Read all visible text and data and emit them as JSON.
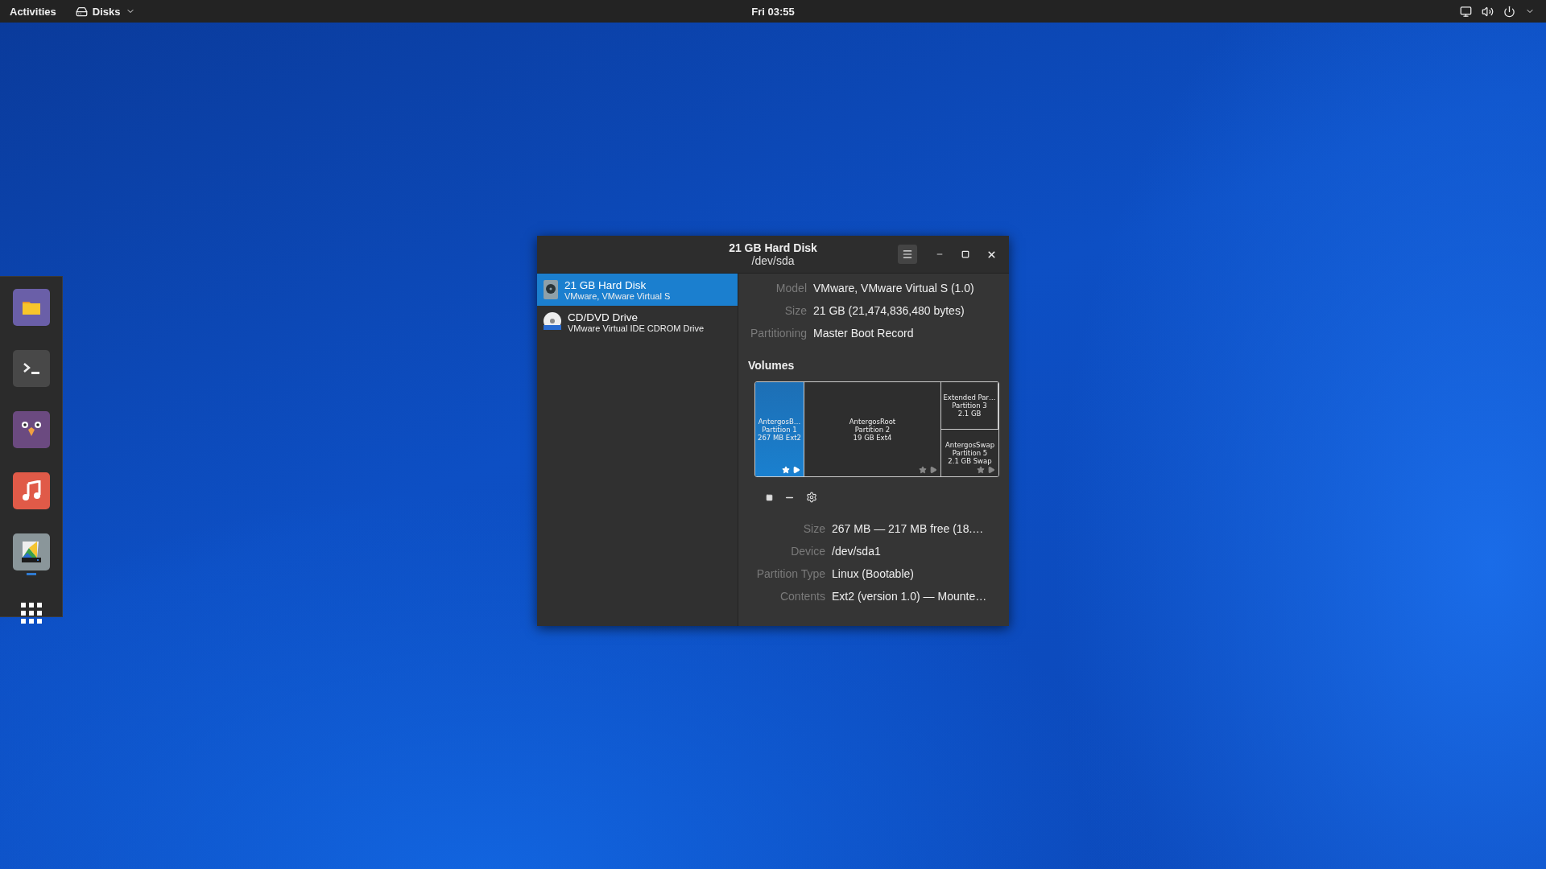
{
  "top_bar": {
    "activities": "Activities",
    "app_menu": {
      "label": "Disks"
    },
    "clock": "Fri 03:55"
  },
  "dock": {
    "items": [
      {
        "kind": "files",
        "running": false
      },
      {
        "kind": "terminal",
        "running": false
      },
      {
        "kind": "chat",
        "running": false
      },
      {
        "kind": "music",
        "running": false
      },
      {
        "kind": "disks",
        "running": true
      },
      {
        "kind": "apps",
        "running": false
      }
    ]
  },
  "window": {
    "title": "21 GB Hard Disk",
    "subtitle": "/dev/sda",
    "drives": [
      {
        "kind": "hdd",
        "name": "21 GB Hard Disk",
        "detail": "VMware, VMware Virtual S",
        "selected": true
      },
      {
        "kind": "dvd",
        "name": "CD/DVD Drive",
        "detail": "VMware Virtual IDE CDROM Drive",
        "selected": false
      }
    ],
    "info": [
      {
        "label": "Model",
        "value": "VMware, VMware Virtual S (1.0)"
      },
      {
        "label": "Size",
        "value": "21 GB (21,474,836,480 bytes)"
      },
      {
        "label": "Partitioning",
        "value": "Master Boot Record"
      }
    ],
    "volumes_heading": "Volumes",
    "volumes": [
      {
        "kind": "partition",
        "lines": [
          "AntergosB…",
          "Partition 1",
          "267 MB Ext2"
        ],
        "selected": true
      },
      {
        "kind": "partition",
        "lines": [
          "AntergosRoot",
          "Partition 2",
          "19 GB Ext4"
        ],
        "selected": false
      },
      {
        "kind": "extended",
        "lines": [
          "Extended Par…",
          "Partition 3",
          "2.1 GB"
        ],
        "selected": false,
        "children": [
          {
            "kind": "partition",
            "lines": [
              "AntergosSwap",
              "Partition 5",
              "2.1 GB Swap"
            ],
            "selected": false
          }
        ]
      }
    ],
    "details": [
      {
        "label": "Size",
        "value": "267 MB — 217 MB free (18.…"
      },
      {
        "label": "Device",
        "value": "/dev/sda1"
      },
      {
        "label": "Partition Type",
        "value": "Linux (Bootable)"
      },
      {
        "label": "Contents",
        "value": "Ext2 (version 1.0) — Mounte…"
      }
    ]
  }
}
